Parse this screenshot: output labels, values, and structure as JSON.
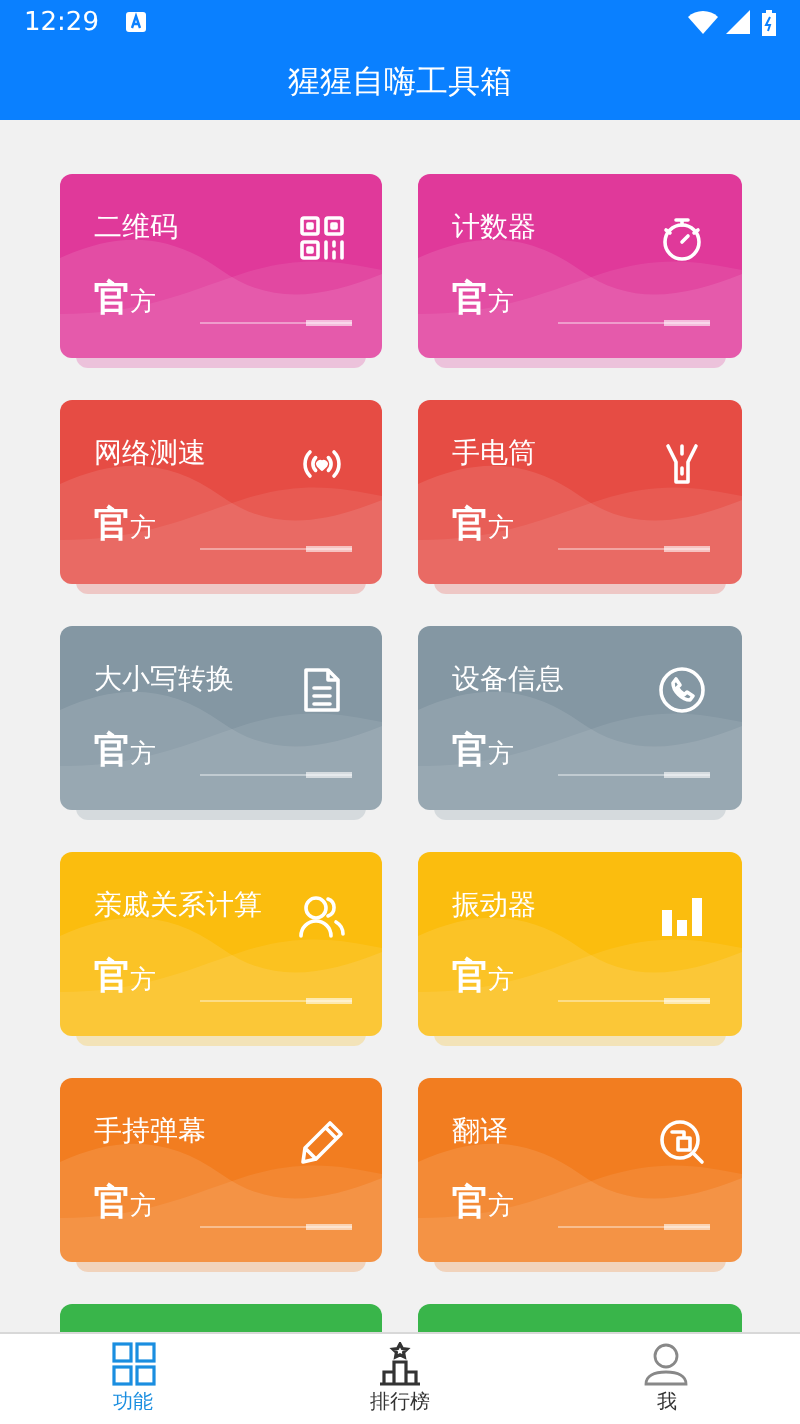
{
  "status_bar": {
    "time": "12:29"
  },
  "app_bar": {
    "title": "猩猩自嗨工具箱"
  },
  "cards": [
    {
      "title": "二维码",
      "badge_big": "官",
      "badge_small": "方",
      "color": "#e0399a",
      "kind": "qr"
    },
    {
      "title": "计数器",
      "badge_big": "官",
      "badge_small": "方",
      "color": "#e0399a",
      "kind": "timer"
    },
    {
      "title": "网络测速",
      "badge_big": "官",
      "badge_small": "方",
      "color": "#e64c44",
      "kind": "signal"
    },
    {
      "title": "手电筒",
      "badge_big": "官",
      "badge_small": "方",
      "color": "#e64c44",
      "kind": "flashlight"
    },
    {
      "title": "大小写转换",
      "badge_big": "官",
      "badge_small": "方",
      "color": "#8497a3",
      "kind": "document"
    },
    {
      "title": "设备信息",
      "badge_big": "官",
      "badge_small": "方",
      "color": "#8497a3",
      "kind": "phone"
    },
    {
      "title": "亲戚关系计算",
      "badge_big": "官",
      "badge_small": "方",
      "color": "#fbbd0e",
      "kind": "people"
    },
    {
      "title": "振动器",
      "badge_big": "官",
      "badge_small": "方",
      "color": "#fbbd0e",
      "kind": "bars"
    },
    {
      "title": "手持弹幕",
      "badge_big": "官",
      "badge_small": "方",
      "color": "#f27d20",
      "kind": "pencil"
    },
    {
      "title": "翻译",
      "badge_big": "官",
      "badge_small": "方",
      "color": "#f27d20",
      "kind": "translate"
    },
    {
      "color": "#39b54a",
      "kind": "blank"
    },
    {
      "color": "#39b54a",
      "kind": "blank"
    }
  ],
  "tabs": [
    {
      "label": "功能",
      "selected": true,
      "kind": "grid"
    },
    {
      "label": "排行榜",
      "selected": false,
      "kind": "podium"
    },
    {
      "label": "我",
      "selected": false,
      "kind": "person"
    }
  ]
}
